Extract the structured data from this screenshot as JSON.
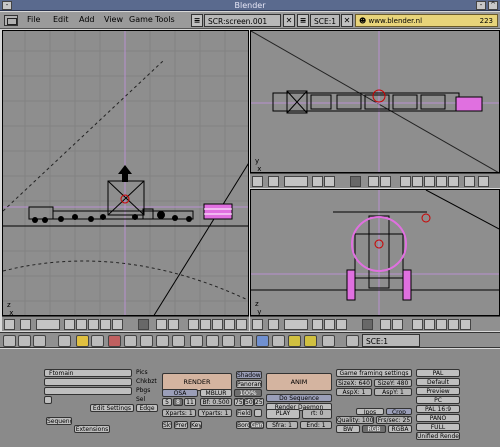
{
  "window": {
    "title": "Blender"
  },
  "menu": {
    "items": [
      "File",
      "Edit",
      "Add",
      "View",
      "Game",
      "Tools"
    ],
    "screen_field": "SCR:screen.001",
    "scene_field": "SCE:1",
    "website": "www.blender.nl",
    "counter": "223"
  },
  "viewports": {
    "left": {
      "axis": "z\n  x"
    },
    "top_right": {
      "axis": "y\n  x"
    },
    "bottom_right": {
      "axis": "z\n  y"
    }
  },
  "buttons_header": {
    "scene_field": "SCE:1"
  },
  "panel": {
    "left_fields": [
      "Ftomain",
      "",
      ""
    ],
    "left_labels": [
      "Pics",
      "Chkbzt",
      "Pbgs",
      "Sel"
    ],
    "edit_settings": "Edit Settings",
    "edge": "Edge",
    "sequencer": "Sequencer",
    "extensions": "Extensions",
    "render": "RENDER",
    "shadows": "Shadows",
    "panorama": "Panorama",
    "anim": "ANIM",
    "do_sequence": "Do Sequence",
    "render_daemon": "Render Daemon",
    "osa": "OSA",
    "mblur": "MBLUR",
    "pct100": "100%",
    "osa_vals": [
      "5",
      "8",
      "11"
    ],
    "blur_val": "Bf: 0.500",
    "pcts": [
      "75%",
      "50%",
      "25%"
    ],
    "xparts": "Xparts: 1",
    "yparts": "Yparts: 1",
    "fields": "Fields",
    "play": "PLAY",
    "rt": "rt: 0",
    "sky": "Sky",
    "premul": "Premul",
    "key": "Key",
    "border": "Border",
    "gamma": "Gamma",
    "sfra": "Sfra: 1",
    "efra": "End: 1",
    "game_framing": "Game framing settings",
    "sizex": "SizeX: 640",
    "sizey": "SizeY: 480",
    "aspx": "AspX: 1",
    "aspy": "AspY: 1",
    "ipos": "Ipos",
    "crop": "Crop",
    "quality": "Quality: 100",
    "frsec": "Frs/sec: 25",
    "bw": "BW",
    "rgb": "RGB",
    "rgba": "RGBA",
    "presets": [
      "PAL",
      "Default",
      "Preview",
      "PC",
      "PAL 16:9",
      "PANO",
      "FULL",
      "Unified Renderer"
    ]
  }
}
